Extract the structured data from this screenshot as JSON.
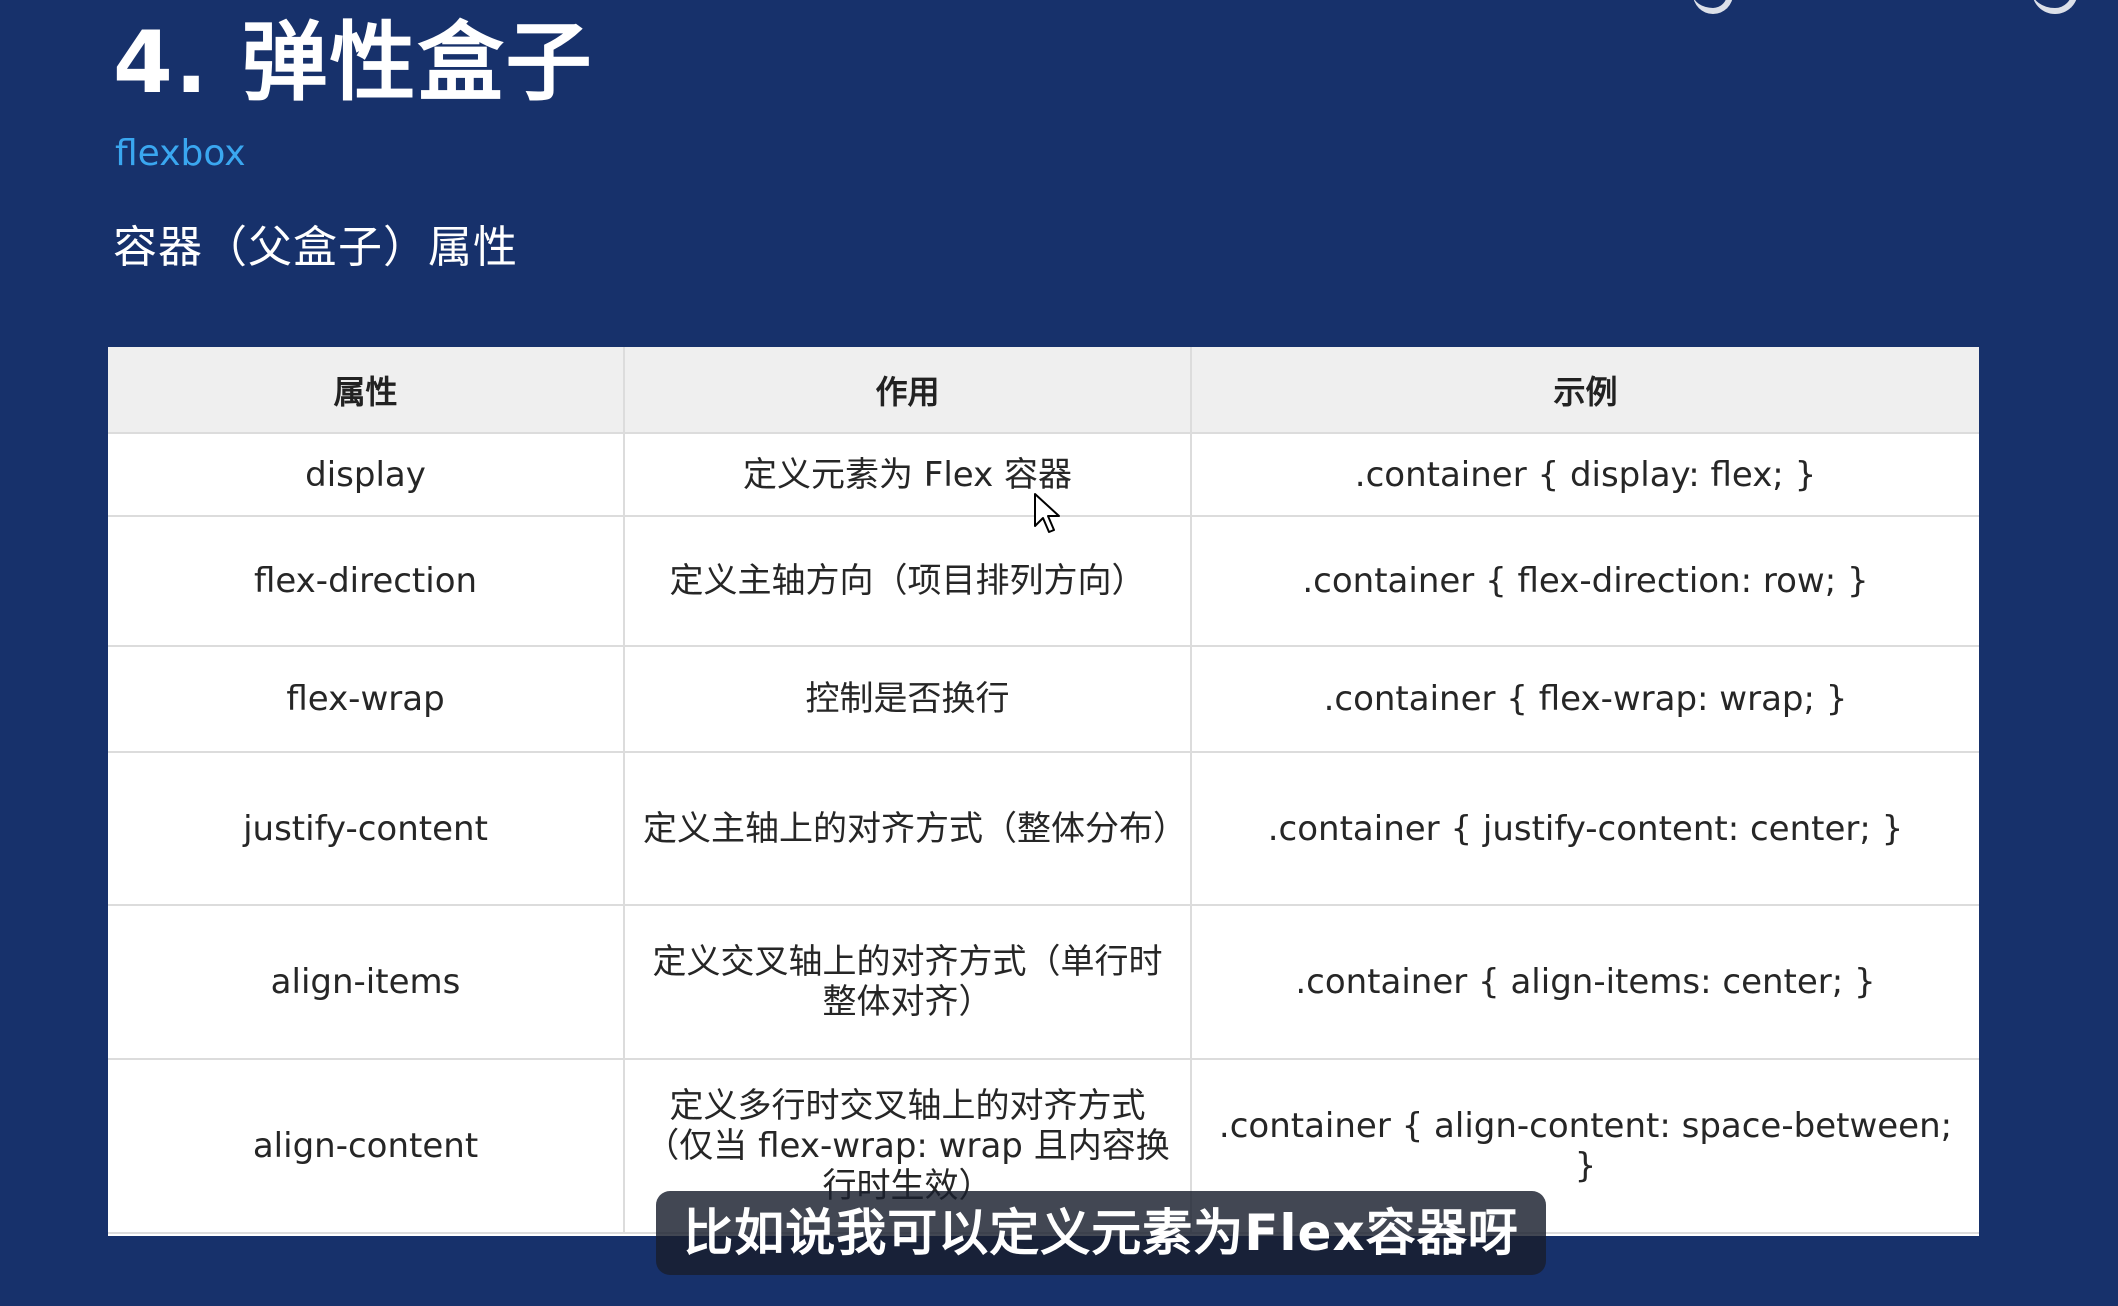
{
  "slide": {
    "title": "4. 弹性盒子",
    "subtitle": "flexbox",
    "section_heading": "容器（父盒子）属性"
  },
  "table": {
    "headers": [
      "属性",
      "作用",
      "示例"
    ],
    "rows": [
      {
        "property": "display",
        "purpose": "定义元素为 Flex 容器",
        "example": ".container { display: flex; }"
      },
      {
        "property": "flex-direction",
        "purpose": "定义主轴方向（项目排列方向）",
        "example": ".container { flex-direction: row; }"
      },
      {
        "property": "flex-wrap",
        "purpose": "控制是否换行",
        "example": ".container { flex-wrap: wrap; }"
      },
      {
        "property": "justify-content",
        "purpose": "定义主轴上的对齐方式（整体分布）",
        "example": ".container { justify-content: center; }"
      },
      {
        "property": "align-items",
        "purpose": "定义交叉轴上的对齐方式（单行时整体对齐）",
        "example": ".container { align-items: center; }"
      },
      {
        "property": "align-content",
        "purpose": "定义多行时交叉轴上的对齐方式（仅当 flex-wrap: wrap 且内容换行时生效）",
        "example": ".container { align-content: space-between; }"
      }
    ]
  },
  "caption": {
    "text": "比如说我可以定义元素为Flex容器呀"
  },
  "cursor": {
    "icon": "mouse-pointer-icon"
  },
  "colors": {
    "background": "#17316b",
    "subtitle": "#3aa7f0",
    "table_header_bg": "#efefef",
    "table_border": "#dcdcdc",
    "caption_bg": "#191e2d"
  }
}
